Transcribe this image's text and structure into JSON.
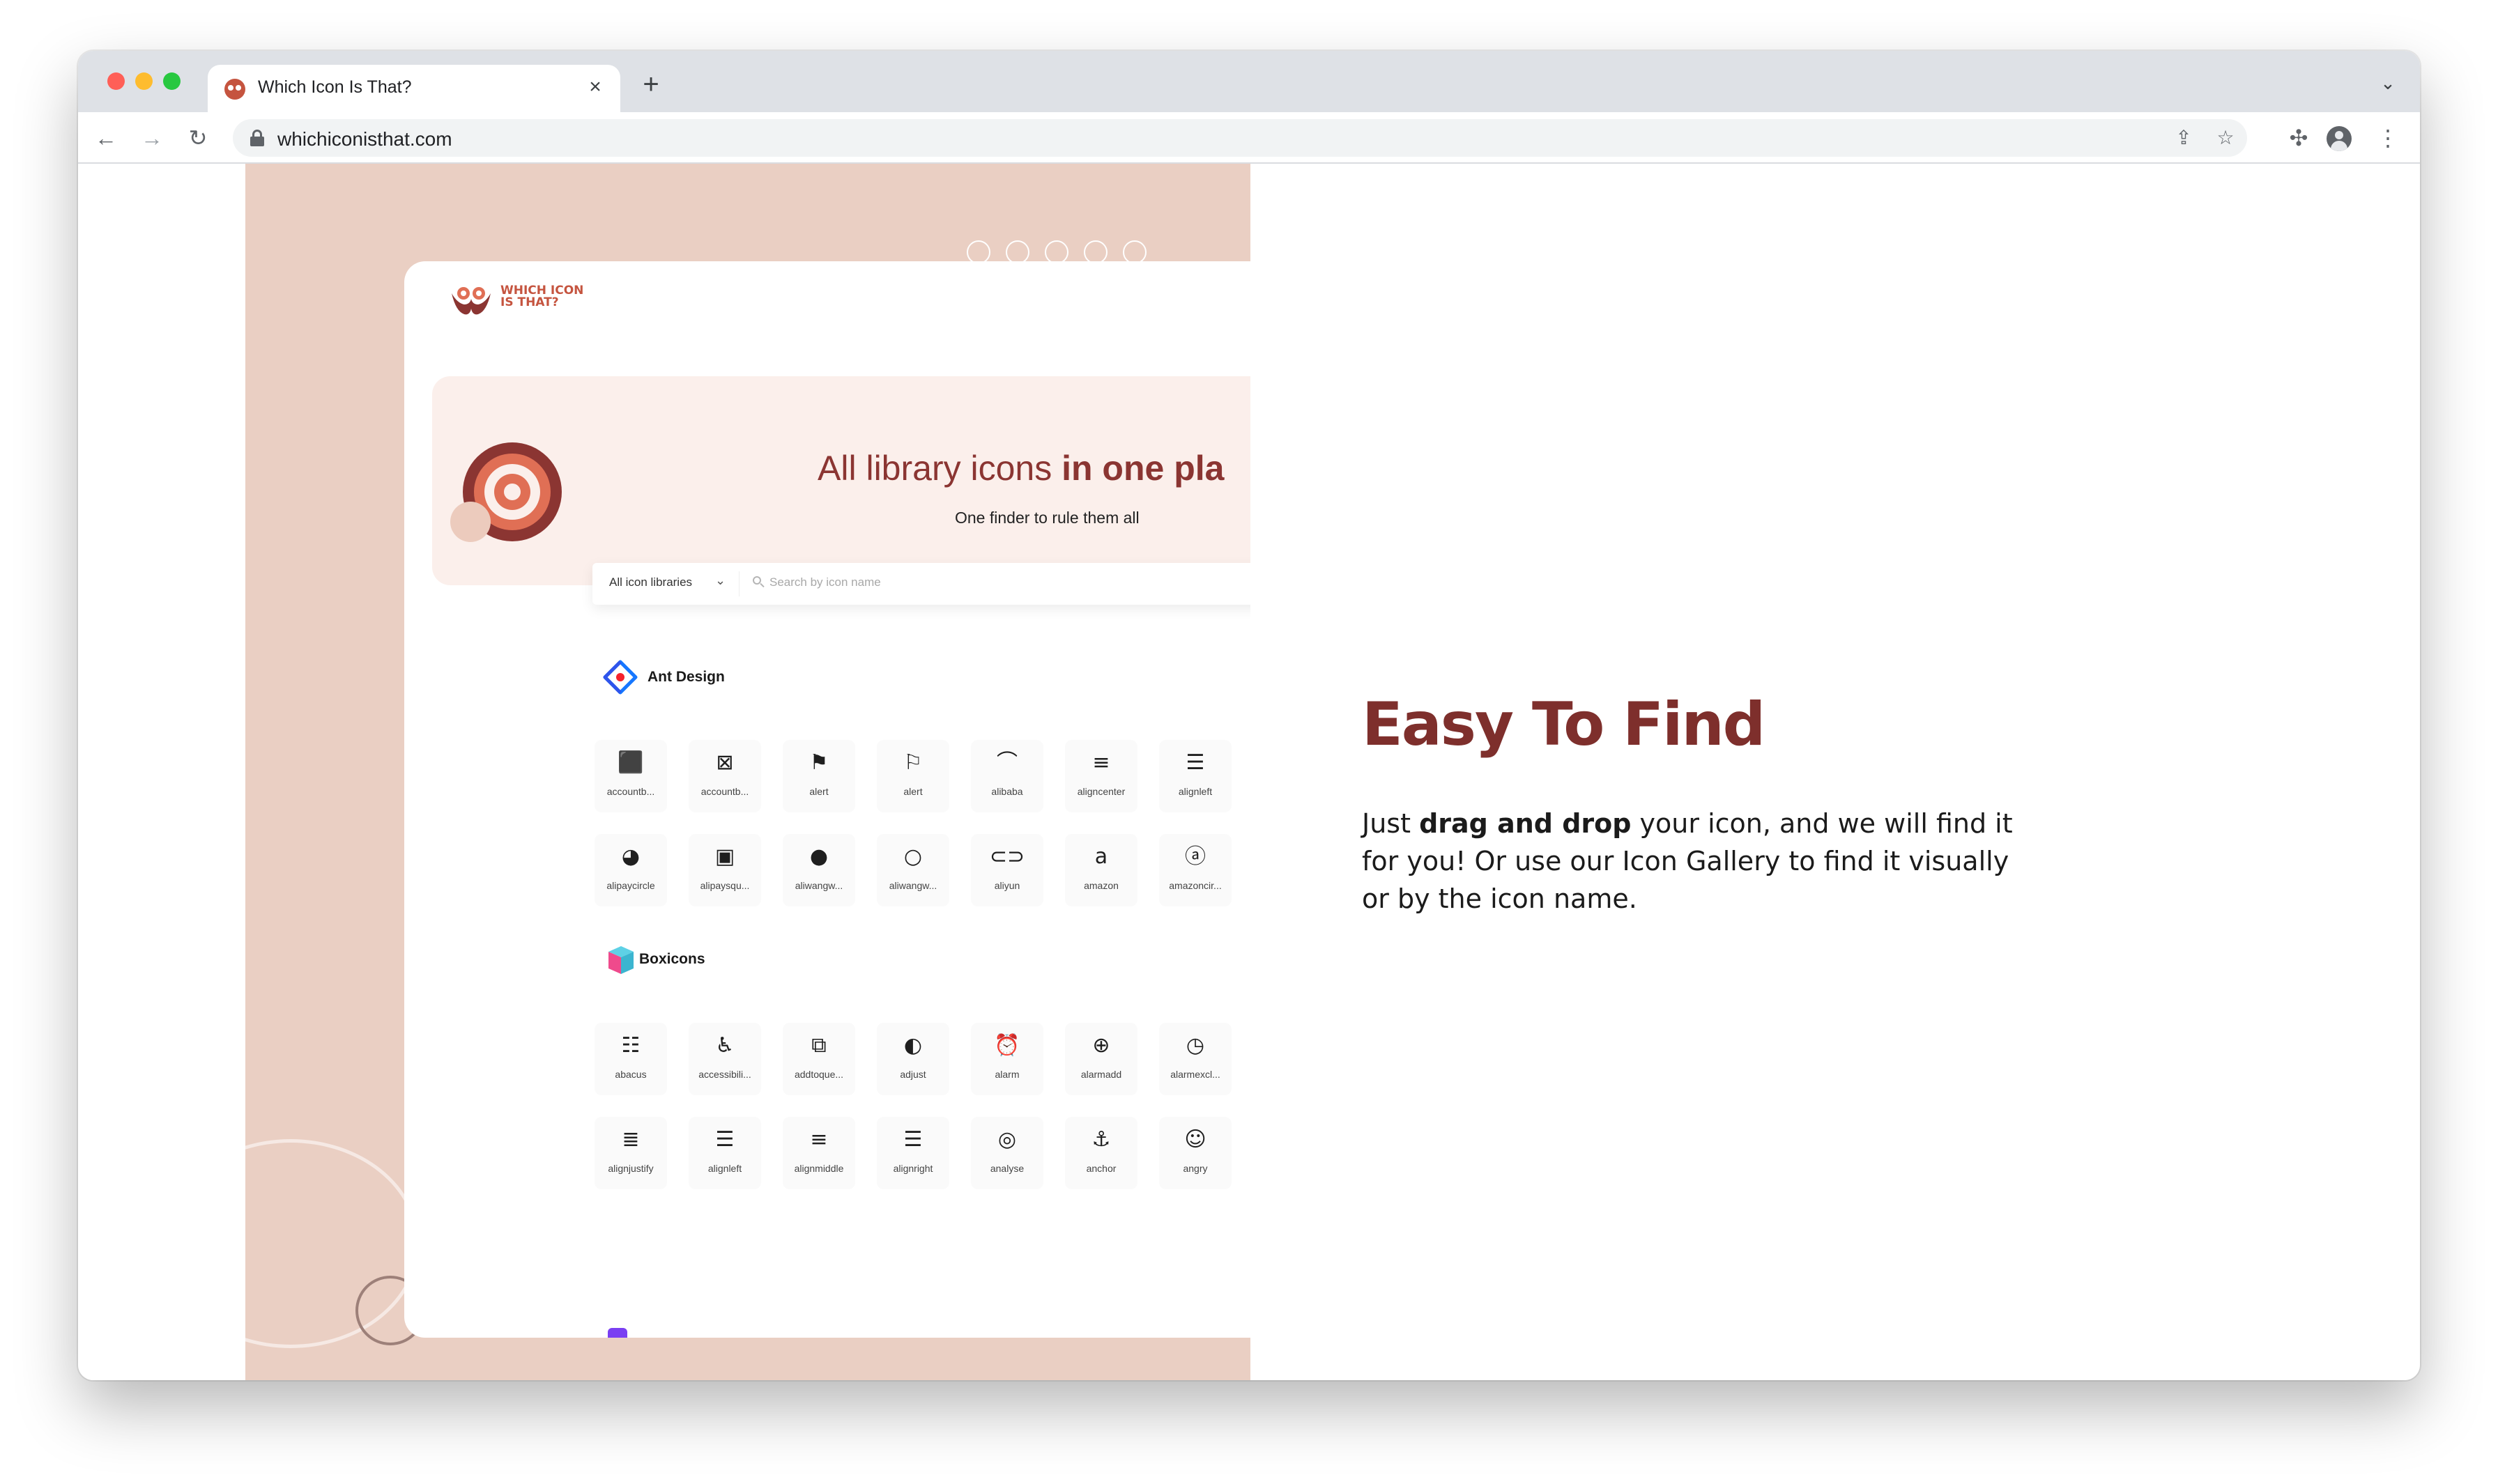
{
  "browser": {
    "tab_title": "Which Icon Is That?",
    "tab_close_icon": "close-icon",
    "new_tab_icon": "plus-icon",
    "url": "whichiconisthat.com",
    "nav": {
      "back": "arrow-left-icon",
      "forward": "arrow-right-icon",
      "reload": "reload-icon"
    },
    "omnibox_icons": [
      "share-icon",
      "star-icon"
    ],
    "toolbar_icons": [
      "puzzle-icon",
      "profile-icon",
      "more-vertical-icon"
    ]
  },
  "preview": {
    "logo_text": "WHICH ICON IS THAT?",
    "hero": {
      "title_regular": "All library icons ",
      "title_bold": "in one pla",
      "subtitle": "One finder to rule them all"
    },
    "search": {
      "library_select": "All icon libraries",
      "placeholder": "Search by icon name"
    },
    "libraries": [
      {
        "name": "Ant Design",
        "icons": [
          {
            "glyph": "⬛",
            "name": "accountb..."
          },
          {
            "glyph": "⊠",
            "name": "accountb..."
          },
          {
            "glyph": "⚑",
            "name": "alert"
          },
          {
            "glyph": "⚐",
            "name": "alert"
          },
          {
            "glyph": "⌒",
            "name": "alibaba"
          },
          {
            "glyph": "≡",
            "name": "aligncenter"
          },
          {
            "glyph": "☰",
            "name": "alignleft"
          },
          {
            "glyph": "◕",
            "name": "alipaycircle"
          },
          {
            "glyph": "▣",
            "name": "alipaysqu..."
          },
          {
            "glyph": "●",
            "name": "aliwangw..."
          },
          {
            "glyph": "○",
            "name": "aliwangw..."
          },
          {
            "glyph": "⊂⊃",
            "name": "aliyun"
          },
          {
            "glyph": "a",
            "name": "amazon"
          },
          {
            "glyph": "ⓐ",
            "name": "amazoncir..."
          }
        ]
      },
      {
        "name": "Boxicons",
        "icons": [
          {
            "glyph": "☷",
            "name": "abacus"
          },
          {
            "glyph": "♿",
            "name": "accessibili..."
          },
          {
            "glyph": "⧉",
            "name": "addtoque..."
          },
          {
            "glyph": "◐",
            "name": "adjust"
          },
          {
            "glyph": "⏰",
            "name": "alarm"
          },
          {
            "glyph": "⊕",
            "name": "alarmadd"
          },
          {
            "glyph": "◷",
            "name": "alarmexcl..."
          },
          {
            "glyph": "≣",
            "name": "alignjustify"
          },
          {
            "glyph": "☰",
            "name": "alignleft"
          },
          {
            "glyph": "≡",
            "name": "alignmiddle"
          },
          {
            "glyph": "☰",
            "name": "alignright"
          },
          {
            "glyph": "◎",
            "name": "analyse"
          },
          {
            "glyph": "⚓",
            "name": "anchor"
          },
          {
            "glyph": "☺",
            "name": "angry"
          }
        ]
      }
    ]
  },
  "feature": {
    "title": "Easy To Find",
    "body_pre": "Just ",
    "body_bold": "drag and drop",
    "body_post": " your icon, and we will find it for you! Or use our Icon Gallery to find it visually or by the icon name."
  },
  "colors": {
    "brand": "#7e2f2c",
    "accent": "#e06f55",
    "preview_bg": "#eacfc3",
    "hero_bg": "#fbefeb"
  }
}
